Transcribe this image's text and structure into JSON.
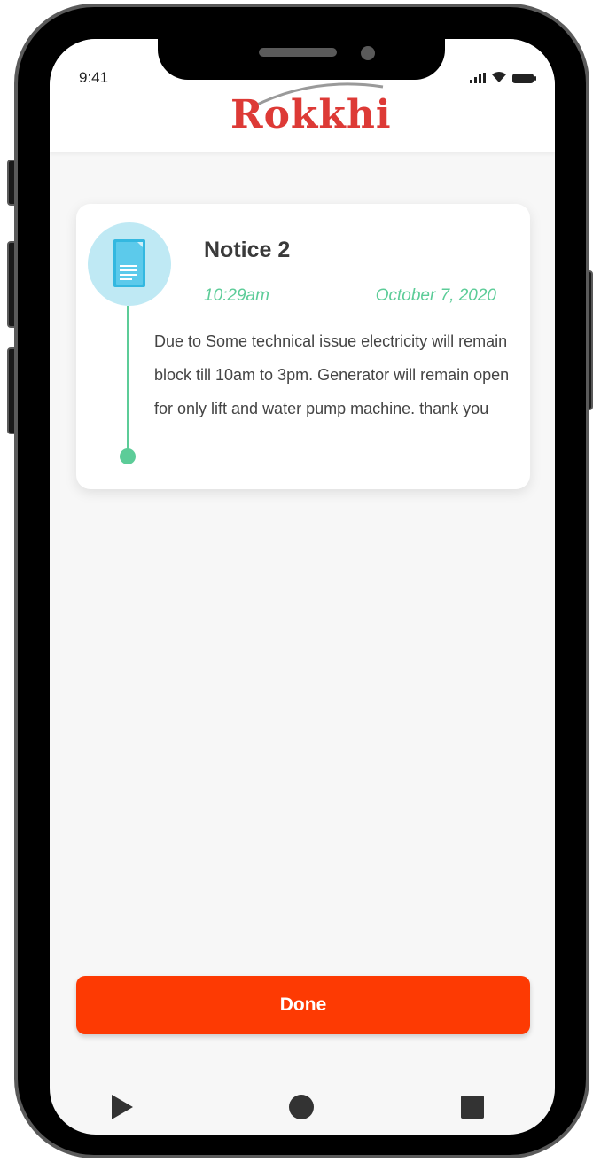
{
  "status_bar": {
    "time": "9:41"
  },
  "header": {
    "logo_text": "Rokkhi",
    "logo_color": "#dd3a36"
  },
  "notice": {
    "title": "Notice 2",
    "time": "10:29am",
    "date": "October 7, 2020",
    "body": "Due to Some technical issue electricity will remain block till 10am to 3pm. Generator will remain open for only lift and water pump machine. thank you",
    "icon": "document-icon",
    "accent_color": "#5ccc98"
  },
  "actions": {
    "done_label": "Done",
    "done_color": "#fd3a03"
  },
  "nav": {
    "back_icon": "back-triangle-icon",
    "home_icon": "home-circle-icon",
    "recent_icon": "recent-square-icon"
  }
}
